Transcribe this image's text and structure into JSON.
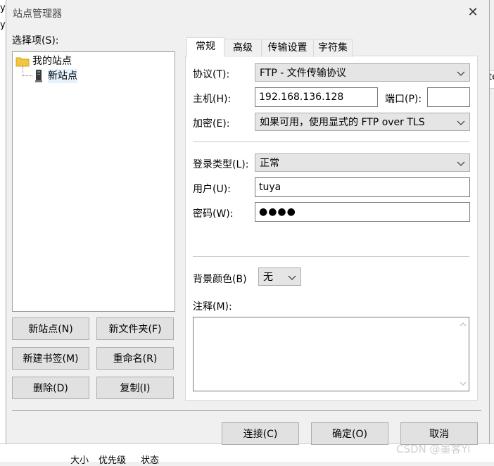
{
  "background": {
    "edge_text": [
      "ys",
      "ys"
    ],
    "edge_right": "te",
    "bottom_cols": [
      "大小",
      "优先级",
      "状态"
    ]
  },
  "window": {
    "title": "站点管理器",
    "close_icon": "✕"
  },
  "select_entry": {
    "label": "选择项(S):"
  },
  "tree": {
    "root": {
      "label": "我的站点",
      "icon": "folder-icon"
    },
    "child": {
      "label": "新站点",
      "icon": "server-icon"
    }
  },
  "left_buttons": {
    "new_site": "新站点(N)",
    "new_folder": "新文件夹(F)",
    "new_bookmark": "新建书签(M)",
    "rename": "重命名(R)",
    "delete": "删除(D)",
    "copy": "复制(I)"
  },
  "tabs": [
    "常规",
    "高级",
    "传输设置",
    "字符集"
  ],
  "general": {
    "protocol_label": "协议(T):",
    "protocol_value": "FTP - 文件传输协议",
    "host_label": "主机(H):",
    "host_value": "192.168.136.128",
    "port_label": "端口(P):",
    "port_value": "",
    "encryption_label": "加密(E):",
    "encryption_value": "如果可用，使用显式的 FTP over TLS",
    "logon_label": "登录类型(L):",
    "logon_value": "正常",
    "user_label": "用户(U):",
    "user_value": "tuya",
    "password_label": "密码(W):",
    "password_value": "●●●●",
    "bgcolor_label": "背景颜色(B)",
    "bgcolor_value": "无",
    "comments_label": "注释(M):",
    "comments_value": ""
  },
  "footer": {
    "connect": "连接(C)",
    "ok": "确定(O)",
    "cancel": "取消"
  },
  "watermark": "CSDN @墨客Yi"
}
